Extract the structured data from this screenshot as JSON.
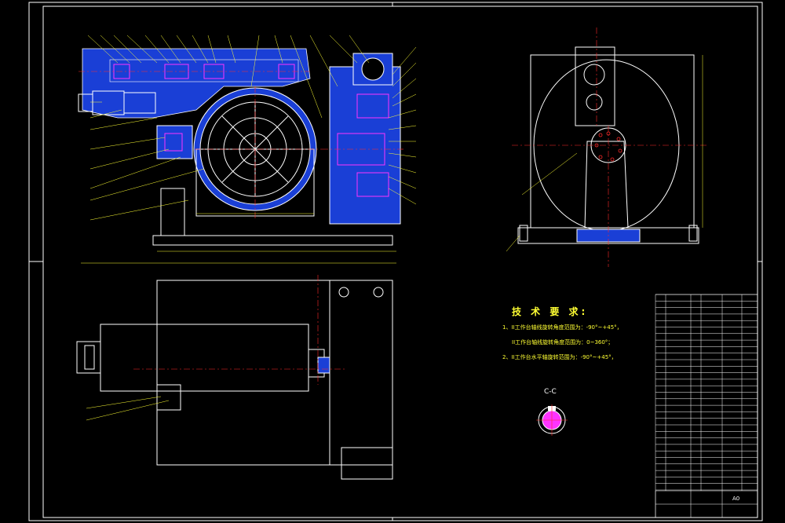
{
  "drawing": {
    "section_label": "C-C",
    "sheet_size": "A0"
  },
  "tech_requirements": {
    "title": "技 术 要 求:",
    "lines": [
      "1、II工作台轴线旋转角度范围为：-90°~+45°，",
      "II工作台轴线旋转角度范围为：0~360°；",
      "2、II工作台水平轴旋转范围为：-90°~+45°，"
    ]
  },
  "colors": {
    "background": "#000000",
    "outline": "#ffffff",
    "blue_fill": "#1a3fd6",
    "centerline": "#ff2a2a",
    "leader": "#ffff33",
    "hatch": "#00ffff",
    "magenta": "#ff33ff"
  },
  "icons": [
    "worm-gear-wheel",
    "bearing-section",
    "shaft-section"
  ]
}
